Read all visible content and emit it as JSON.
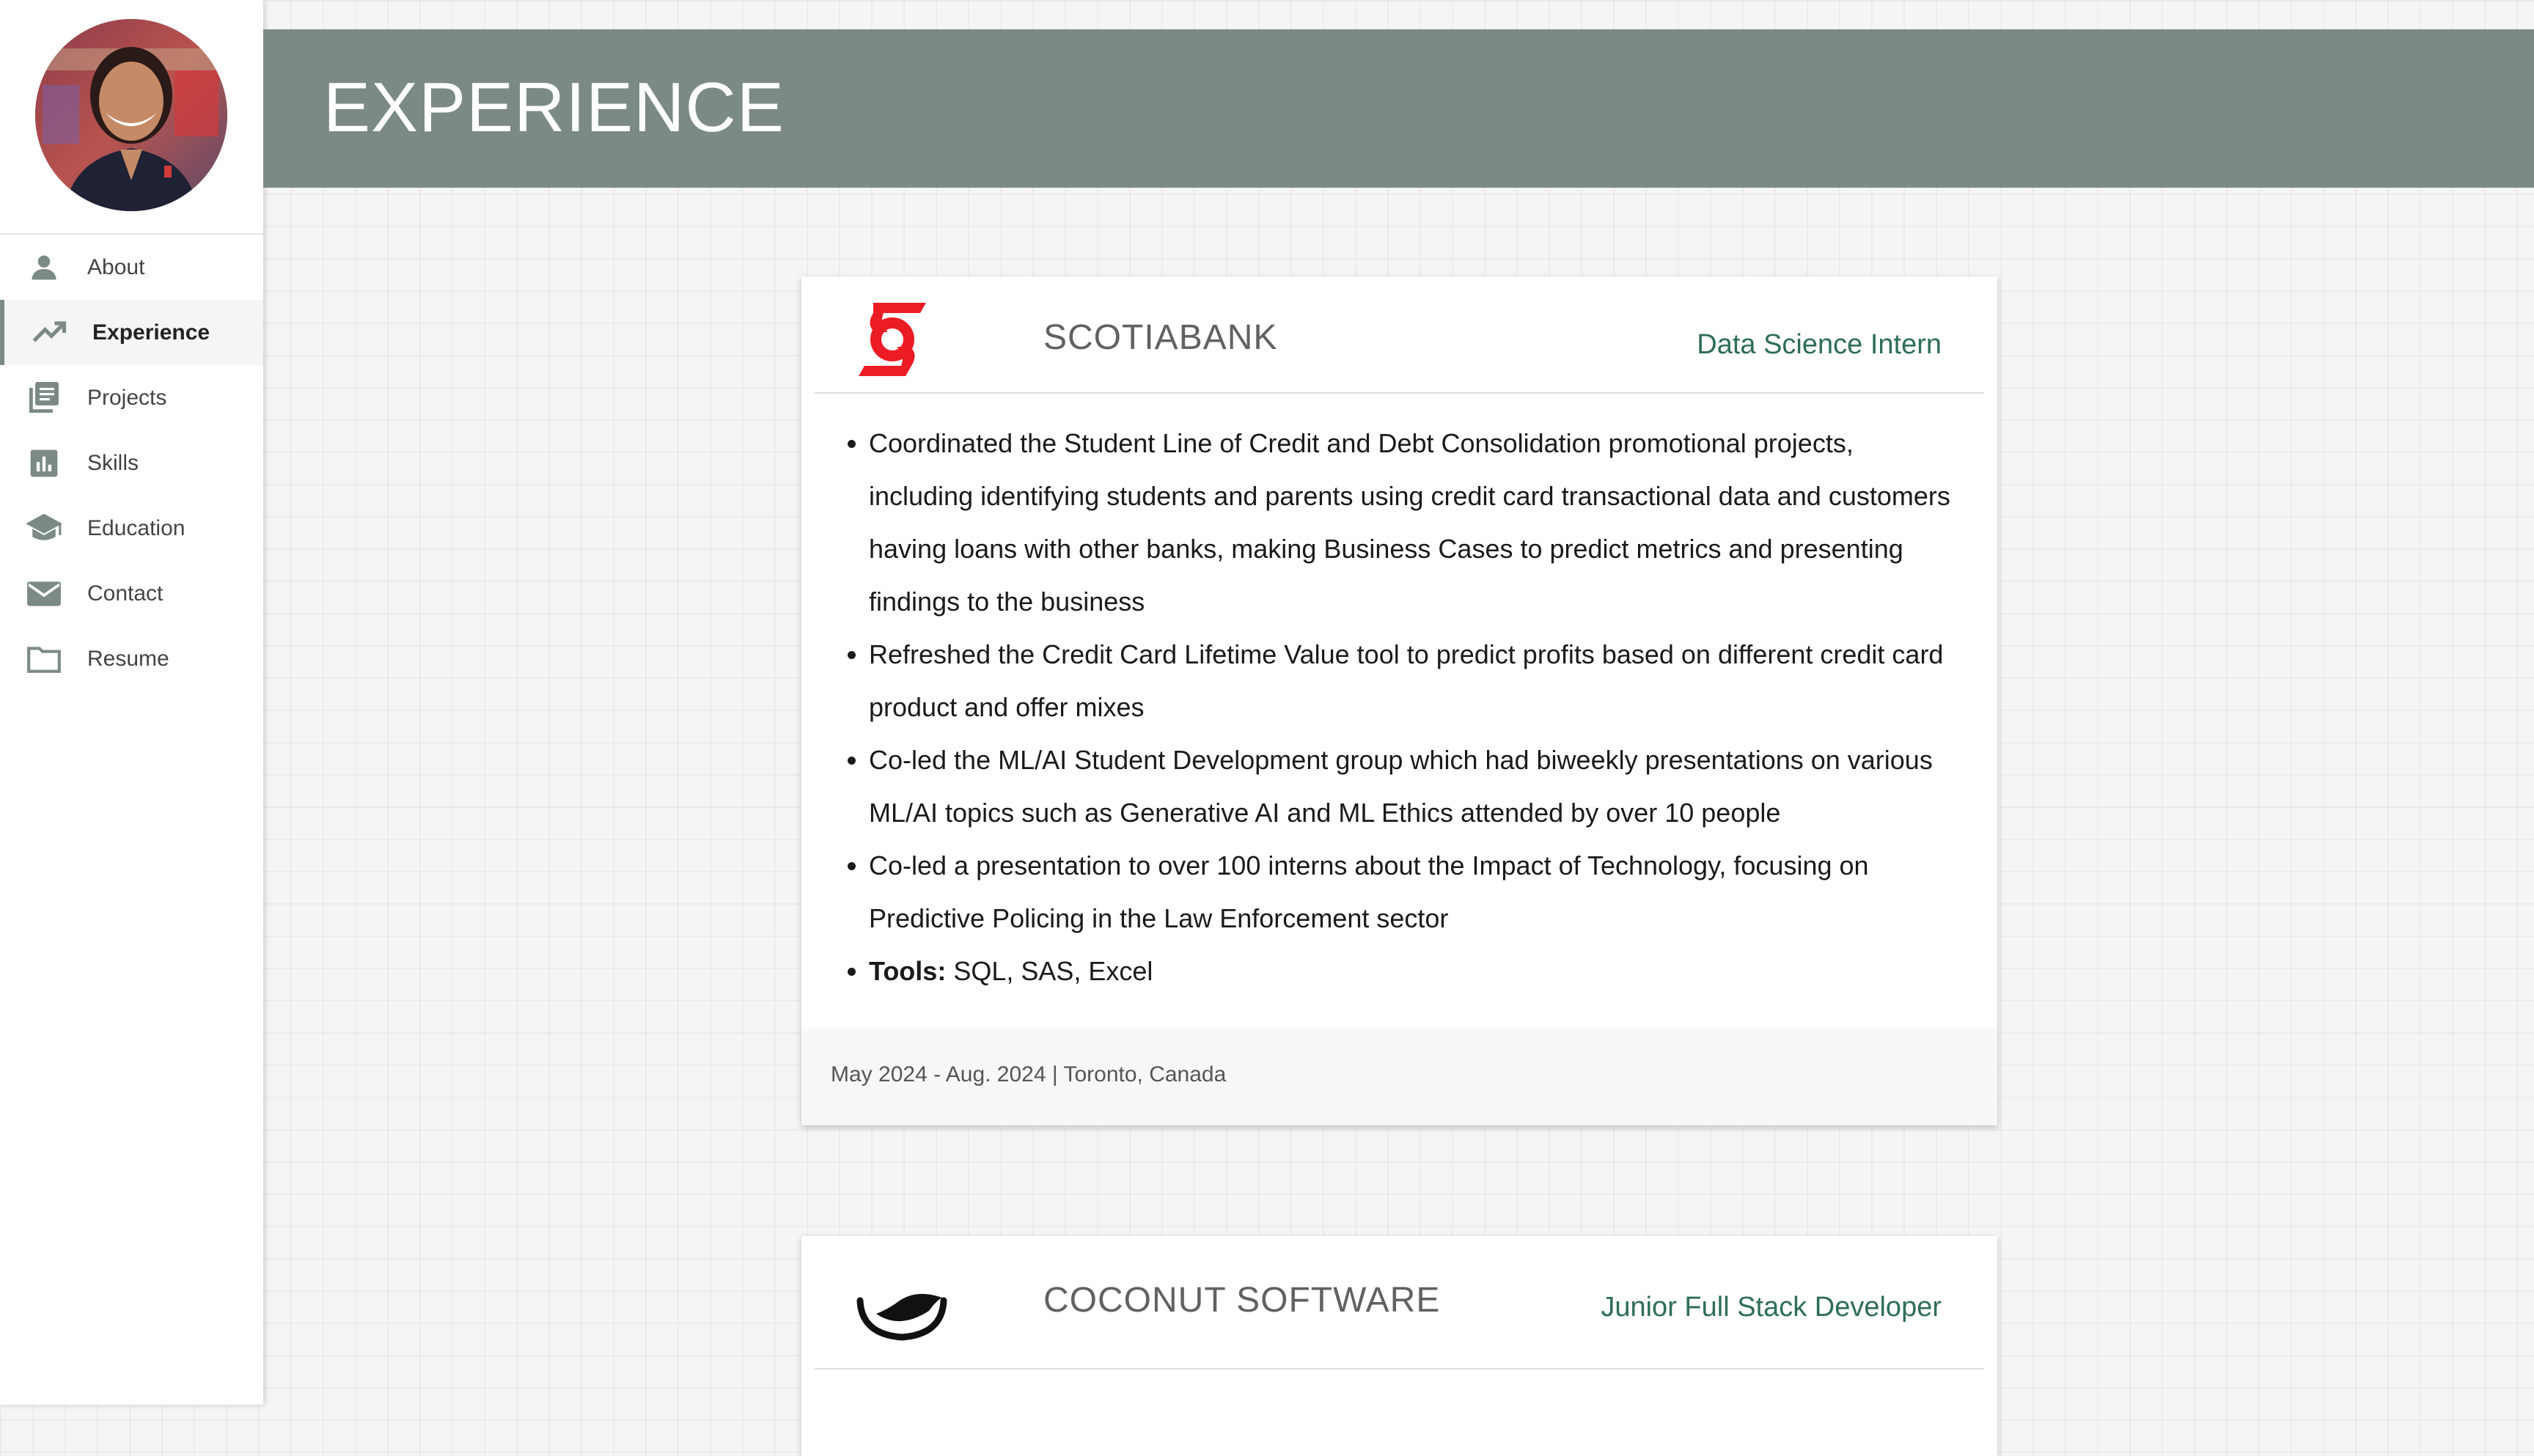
{
  "sidebar": {
    "items": [
      {
        "label": "About",
        "icon": "person-icon"
      },
      {
        "label": "Experience",
        "icon": "trending-up-icon"
      },
      {
        "label": "Projects",
        "icon": "library-icon"
      },
      {
        "label": "Skills",
        "icon": "bar-chart-icon"
      },
      {
        "label": "Education",
        "icon": "graduation-cap-icon"
      },
      {
        "label": "Contact",
        "icon": "envelope-icon"
      },
      {
        "label": "Resume",
        "icon": "folder-icon"
      }
    ],
    "active": "Experience"
  },
  "header": {
    "title": "EXPERIENCE"
  },
  "colors": {
    "header_band": "#7b8b84",
    "role_text": "#2e6e55",
    "scotiabank_red": "#ec1c24"
  },
  "experience": [
    {
      "company": "SCOTIABANK",
      "role": "Data Science Intern",
      "logo": "scotiabank-logo",
      "bullets": [
        "Coordinated the Student Line of Credit and Debt Consolidation promotional projects, including identifying students and parents using credit card transactional data and customers having loans with other banks, making Business Cases to predict metrics and presenting findings to the business",
        "Refreshed the Credit Card Lifetime Value tool to predict profits based on different credit card product and offer mixes",
        "Co-led the ML/AI Student Development group which had biweekly presentations on various ML/AI topics such as Generative AI and ML Ethics attended by over 10 people",
        "Co-led a presentation to over 100 interns about the Impact of Technology, focusing on Predictive Policing in the Law Enforcement sector"
      ],
      "tools_label": "Tools:",
      "tools": " SQL, SAS, Excel",
      "footer": "May 2024 - Aug. 2024 | Toronto, Canada"
    },
    {
      "company": "COCONUT SOFTWARE",
      "role": "Junior Full Stack Developer",
      "logo": "coconut-software-logo"
    }
  ]
}
